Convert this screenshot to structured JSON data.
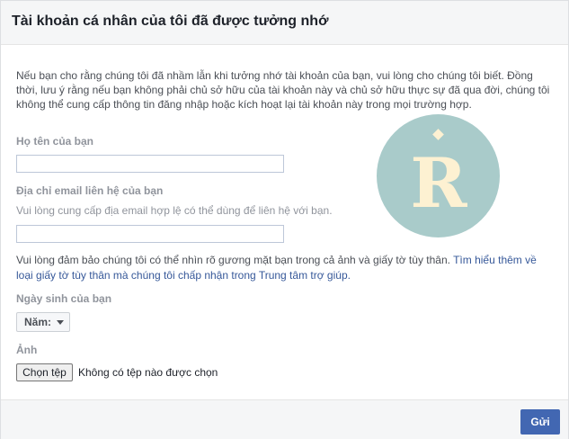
{
  "dialog": {
    "title": "Tài khoản cá nhân của tôi đã được tưởng nhớ",
    "intro": "Nếu bạn cho rằng chúng tôi đã nhầm lẫn khi tưởng nhớ tài khoản của bạn, vui lòng cho chúng tôi biết. Đồng thời, lưu ý rằng nếu bạn không phải chủ sở hữu của tài khoản này và chủ sở hữu thực sự đã qua đời, chúng tôi không thể cung cấp thông tin đăng nhập hoặc kích hoạt lại tài khoản này trong mọi trường hợp."
  },
  "form": {
    "name_label": "Họ tên của bạn",
    "name_value": "",
    "email_label": "Địa chỉ email liên hệ của bạn",
    "email_hint": "Vui lòng cung cấp địa email hợp lệ có thể dùng để liên hệ với bạn.",
    "email_value": "",
    "notice_text": "Vui lòng đảm bảo chúng tôi có thể nhìn rõ gương mặt bạn trong cả ảnh và giấy tờ tùy thân. ",
    "notice_link": "Tìm hiểu thêm về loại giấy tờ tùy thân mà chúng tôi chấp nhận trong Trung tâm trợ giúp.",
    "birthday_label": "Ngày sinh của bạn",
    "year_select": "Năm:",
    "photo_label": "Ảnh",
    "file_button": "Chọn tệp",
    "file_status": "Không có tệp nào được chọn"
  },
  "footer": {
    "submit_label": "Gửi"
  },
  "watermark": {
    "letter": "R",
    "circle_color": "#a9cbca",
    "letter_color": "#fdf1d2"
  },
  "colors": {
    "accent": "#4267b2",
    "link": "#365899"
  }
}
